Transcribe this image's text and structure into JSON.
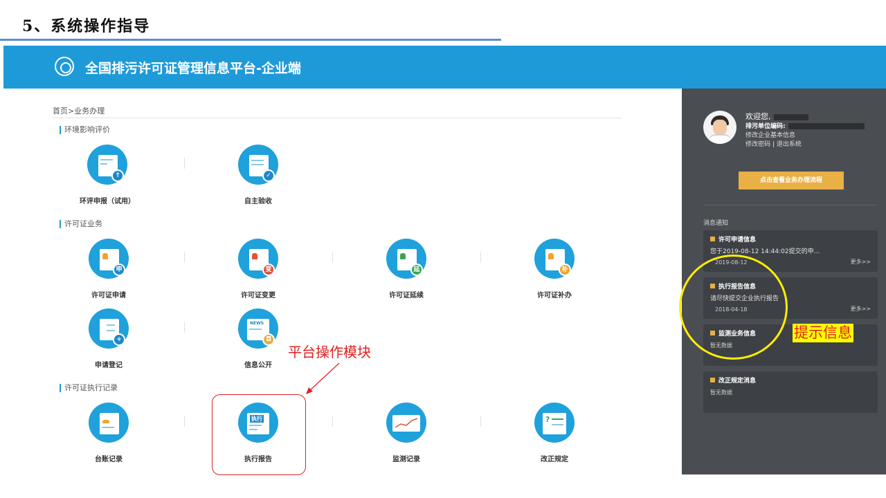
{
  "slide": {
    "title": "5、系统操作指导"
  },
  "app": {
    "title": "全国排污许可证管理信息平台-企业端"
  },
  "breadcrumb": "首页>业务办理",
  "sections": [
    {
      "title": "环境影响评价",
      "modules": [
        {
          "label": "环评申报（试用）",
          "icon": "upload-doc-icon"
        },
        {
          "label": "自主验收",
          "icon": "checklist-icon"
        }
      ]
    },
    {
      "title": "许可证业务",
      "modules": [
        {
          "label": "许可证申请",
          "icon": "license-apply-icon",
          "badge": "申"
        },
        {
          "label": "许可证变更",
          "icon": "license-change-icon",
          "badge": "变"
        },
        {
          "label": "许可证延续",
          "icon": "license-extend-icon",
          "badge": "延"
        },
        {
          "label": "许可证补办",
          "icon": "license-reissue-icon",
          "badge": "补"
        },
        {
          "label": "申请登记",
          "icon": "register-icon"
        },
        {
          "label": "信息公开",
          "icon": "news-icon",
          "news": "NEWS"
        }
      ]
    },
    {
      "title": "许可证执行记录",
      "modules": [
        {
          "label": "台账记录",
          "icon": "ledger-icon"
        },
        {
          "label": "执行报告",
          "icon": "exec-report-icon",
          "tag": "执行"
        },
        {
          "label": "监测记录",
          "icon": "monitor-chart-icon"
        },
        {
          "label": "改正规定",
          "icon": "correction-icon",
          "tag": "?"
        }
      ]
    }
  ],
  "sidebar": {
    "welcome": "欢迎您,",
    "unit_code_label": "排污单位编码:",
    "edit_info": "修改企业基本信息",
    "change_password": "修改密码",
    "link_separator": "|",
    "logout": "退出系统",
    "flow_button": "点击查看业务办理流程",
    "notices_title": "消息通知",
    "cards": [
      {
        "title": "许可申请信息",
        "body": "您于2019-08-12 14:44:02提交的申...",
        "date": "2019-08-12",
        "more": "更多>>"
      },
      {
        "title": "执行报告信息",
        "body": "请尽快提交企业执行报告",
        "date": "2018-04-18",
        "more": "更多>>"
      },
      {
        "title": "监测业务信息",
        "empty": "暂无数据"
      },
      {
        "title": "改正规定消息",
        "empty": "暂无数据"
      }
    ]
  },
  "annotations": {
    "module_note": "平台操作模块",
    "tip_note": "提示信息"
  },
  "colors": {
    "header_blue": "#1e9ad9",
    "sidebar_gray": "#4a4d52",
    "accent_gold": "#e8b045",
    "annotation_red": "#e02020",
    "highlight_yellow": "#ffee00"
  }
}
